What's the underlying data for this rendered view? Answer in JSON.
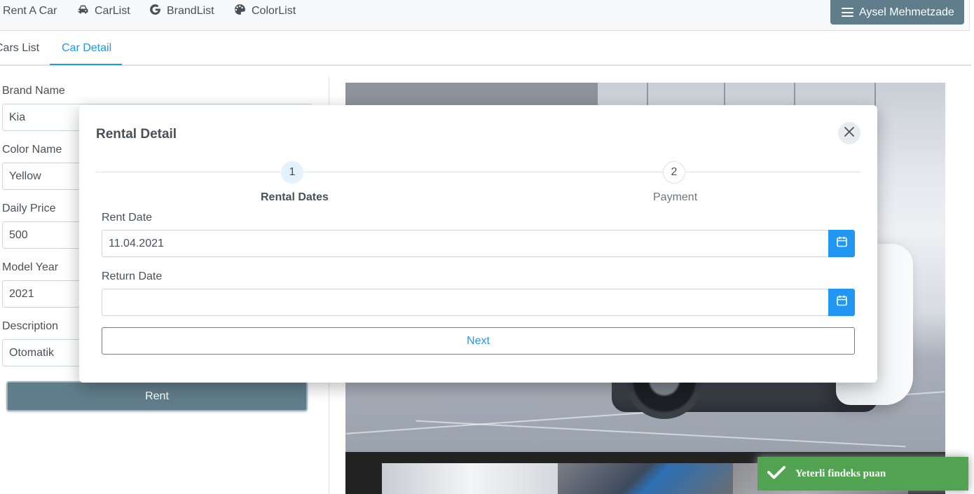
{
  "navbar": {
    "brand": "Rent A Car",
    "links": [
      {
        "label": "CarList",
        "icon": "car-icon"
      },
      {
        "label": "BrandList",
        "icon": "brand-g-icon"
      },
      {
        "label": "ColorList",
        "icon": "palette-icon"
      }
    ],
    "user_label": "Aysel Mehmetzade"
  },
  "tabs": [
    {
      "label": "Cars List",
      "active": false
    },
    {
      "label": "Car Detail",
      "active": true
    }
  ],
  "car_form": {
    "fields": [
      {
        "label": "Brand Name",
        "value": "Kia"
      },
      {
        "label": "Color Name",
        "value": "Yellow"
      },
      {
        "label": "Daily Price",
        "value": "500"
      },
      {
        "label": "Model Year",
        "value": "2021"
      },
      {
        "label": "Description",
        "value": "Otomatik"
      }
    ],
    "rent_button": "Rent"
  },
  "modal": {
    "title": "Rental Detail",
    "close_icon": "close-icon",
    "steps": [
      {
        "number": "1",
        "label": "Rental Dates",
        "active": true
      },
      {
        "number": "2",
        "label": "Payment",
        "active": false
      }
    ],
    "rent_date_label": "Rent Date",
    "rent_date_value": "11.04.2021",
    "return_date_label": "Return Date",
    "return_date_value": "",
    "next_button": "Next",
    "calendar_icon": "calendar-icon"
  },
  "toast": {
    "message": "Yeterli findeks puan",
    "icon": "checkmark-icon"
  },
  "colors": {
    "accent": "#2196f3",
    "user_button": "#607d8b",
    "toast_success": "#51a351"
  }
}
